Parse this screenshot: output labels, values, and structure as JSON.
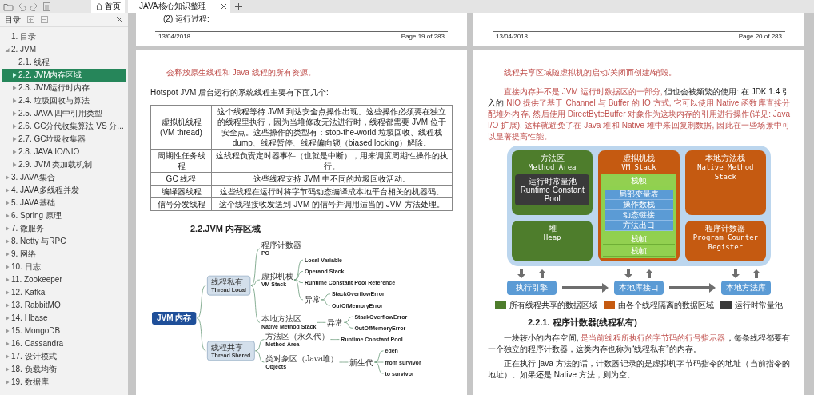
{
  "sidebar": {
    "home_label": "首页",
    "outline": {
      "title": "目录",
      "items": [
        {
          "label": "1. 目录",
          "selected": false
        },
        {
          "label": "2. JVM",
          "selected": false,
          "expanded": true,
          "children": [
            {
              "label": "2.1. 线程",
              "selected": false
            },
            {
              "label": "2.2. JVM内存区域",
              "selected": true,
              "expanded": false
            },
            {
              "label": "2.3. JVM运行时内存",
              "selected": false,
              "expanded": false
            },
            {
              "label": "2.4. 垃圾回收与算法",
              "selected": false,
              "expanded": false
            },
            {
              "label": "2.5. JAVA 四中引用类型",
              "selected": false,
              "expanded": false
            },
            {
              "label": "2.6. GC分代收集算法  VS 分...",
              "selected": false,
              "expanded": false
            },
            {
              "label": "2.7. GC垃圾收集器",
              "selected": false,
              "expanded": false
            },
            {
              "label": "2.8.  JAVA IO/NIO",
              "selected": false,
              "expanded": false
            },
            {
              "label": "2.9. JVM 类加载机制",
              "selected": false,
              "expanded": false
            }
          ]
        },
        {
          "label": "3. JAVA集合",
          "selected": false,
          "expanded": false
        },
        {
          "label": "4. JAVA多线程并发",
          "selected": false,
          "expanded": false
        },
        {
          "label": "5. JAVA基础",
          "selected": false,
          "expanded": false
        },
        {
          "label": "6. Spring 原理",
          "selected": false,
          "expanded": false
        },
        {
          "label": "7.  微服务",
          "selected": false,
          "expanded": false
        },
        {
          "label": "8. Netty 与RPC",
          "selected": false,
          "expanded": false
        },
        {
          "label": "9. 网络",
          "selected": false,
          "expanded": false
        },
        {
          "label": "10. 日志",
          "selected": false,
          "expanded": false
        },
        {
          "label": "11. Zookeeper",
          "selected": false,
          "expanded": false
        },
        {
          "label": "12. Kafka",
          "selected": false,
          "expanded": false
        },
        {
          "label": "13. RabbitMQ",
          "selected": false,
          "expanded": false
        },
        {
          "label": "14. Hbase",
          "selected": false,
          "expanded": false
        },
        {
          "label": "15. MongoDB",
          "selected": false,
          "expanded": false
        },
        {
          "label": "16. Cassandra",
          "selected": false,
          "expanded": false
        },
        {
          "label": "17. 设计模式",
          "selected": false,
          "expanded": false
        },
        {
          "label": "18. 负载均衡",
          "selected": false,
          "expanded": false
        },
        {
          "label": "19. 数据库",
          "selected": false,
          "expanded": false
        }
      ]
    }
  },
  "tabs": [
    {
      "label": "JAVA核心知识整理",
      "selected": true
    }
  ],
  "pages": [
    {
      "tail": {
        "text": "(2) 运行过程:",
        "date": "13/04/2018",
        "page": "Page 19 of 283"
      },
      "blocks": [
        {
          "kind": "note",
          "text": "会释放原生线程和 Java 线程的所有资源。"
        },
        {
          "kind": "text",
          "segments": [
            {
              "text": "Hotspot JVM 后台运行的系统线程主要有下面几个:",
              "highlight": false
            }
          ]
        },
        {
          "kind": "table",
          "rows": [
            [
              "虚拟机线程\n(VM thread)",
              "这个线程等待 JVM 到达安全点操作出现。这些操作必须要在独立的线程里执行，因为当堆修改无法进行时，线程都需要 JVM 位于安全点。这些操作的类型有：stop-the-world 垃圾回收、线程栈 dump、线程暂停、线程偏向锁（biased locking）解除。"
            ],
            [
              "周期性任务线程",
              "这线程负责定时器事件（也就是中断），用来调度周期性操作的执行。"
            ],
            [
              "GC 线程",
              "这些线程支持 JVM 中不同的垃圾回收活动。"
            ],
            [
              "编译器线程",
              "这些线程在运行时将字节码动态编译成本地平台相关的机器码。"
            ],
            [
              "信号分发线程",
              "这个线程接收发送到 JVM 的信号并调用适当的 JVM 方法处理。"
            ]
          ]
        },
        {
          "kind": "heading",
          "text": "2.2.JVM 内存区域"
        },
        {
          "kind": "mindmap",
          "tree": {
            "title": "JVM 内存",
            "children": [
              {
                "title": "线程私有",
                "subtitle": "Thread Local",
                "children": [
                  {
                    "title": "程序计数器",
                    "subtitle": "PC"
                  },
                  {
                    "title": "虚拟机栈",
                    "subtitle": "VM Stack",
                    "children": [
                      {
                        "title": "Local Variable",
                        "kind": "term"
                      },
                      {
                        "title": "Operand Stack",
                        "kind": "term"
                      },
                      {
                        "title": "Runtime Constant Pool Reference",
                        "kind": "term"
                      },
                      {
                        "title": "异常",
                        "children": [
                          {
                            "title": "StackOverflowError",
                            "kind": "term"
                          },
                          {
                            "title": "OutOfMemoryError",
                            "kind": "term"
                          }
                        ]
                      }
                    ]
                  },
                  {
                    "title": "本地方法区",
                    "subtitle": "Native Method Stack",
                    "children": [
                      {
                        "title": "异常",
                        "children": [
                          {
                            "title": "StackOverflowError",
                            "kind": "term"
                          },
                          {
                            "title": "OutOfMemoryError",
                            "kind": "term"
                          }
                        ]
                      }
                    ]
                  }
                ]
              },
              {
                "title": "线程共享",
                "subtitle": "Thread Shared",
                "children": [
                  {
                    "title": "方法区（永久代）",
                    "subtitle": "Method Area",
                    "children": [
                      {
                        "title": "Runtime Constant Pool",
                        "kind": "term"
                      }
                    ]
                  },
                  {
                    "title": "类对象区（Java堆）",
                    "subtitle": "Objects",
                    "children": [
                      {
                        "title": "新生代",
                        "children": [
                          {
                            "title": "eden",
                            "kind": "term"
                          },
                          {
                            "title": "from survivor",
                            "kind": "term"
                          },
                          {
                            "title": "to survivor",
                            "kind": "term"
                          }
                        ]
                      }
                    ]
                  }
                ]
              }
            ]
          }
        }
      ]
    },
    {
      "tail": {
        "date": "13/04/2018",
        "page": "Page 20 of 283"
      },
      "blocks": [
        {
          "kind": "note",
          "text": "线程共享区域随虚拟机的启动/关闭而创建/销毁。"
        },
        {
          "kind": "paragraph",
          "segments": [
            {
              "text": "直接内存并不是 JVM 运行时数据区的一部分, ",
              "highlight": true
            },
            {
              "text": "但也会被频繁的使用: 在 JDK 1.4 引入的 ",
              "highlight": false
            },
            {
              "text": "NIO 提供了基于 Channel 与 Buffer 的 IO 方式, 它可以使用 Native 函数库直接分配堆外内存, 然后使用 DirectByteBuffer 对象作为这块内存的引用进行操作(详见: Java I/O 扩展), 这样就避免了在 Java 堆和 Native 堆中来回复制数据, 因此在一些场景中可以显著提高性能。",
              "highlight": true
            }
          ]
        },
        {
          "kind": "diagram",
          "areas": [
            {
              "kind": "shared",
              "title": "方法区",
              "subtitle": "Method Area",
              "inner": {
                "kind": "pool",
                "title": "运行时常量池",
                "subtitle": "Runtime Constant Pool"
              }
            },
            {
              "kind": "private",
              "title": "虚拟机栈",
              "subtitle": "VM Stack",
              "frames": [
                {
                  "label": "栈帧",
                  "entries": [
                    "局部变量表",
                    "操作数栈",
                    "动态链接",
                    "方法出口"
                  ]
                },
                {
                  "label": "栈帧"
                },
                {
                  "label": "栈帧"
                }
              ]
            },
            {
              "kind": "private",
              "title": "本地方法栈",
              "subtitle": "Native Method Stack"
            },
            {
              "kind": "shared",
              "title": "堆",
              "subtitle": "Heap"
            },
            {
              "kind": "private",
              "title": "程序计数器",
              "subtitle": "Program Counter Register"
            }
          ],
          "interfaces": [
            "执行引擎",
            "本地库接口",
            "本地方法库"
          ],
          "legend": [
            {
              "kind": "shared",
              "label": "所有线程共享的数据区域"
            },
            {
              "kind": "private",
              "label": "由各个线程隔离的数据区域"
            },
            {
              "kind": "pool",
              "label": "运行时常量池"
            }
          ]
        },
        {
          "kind": "heading",
          "text": "2.2.1. 程序计数器(线程私有)"
        },
        {
          "kind": "paragraph",
          "segments": [
            {
              "text": "一块较小的内存空间, ",
              "highlight": false
            },
            {
              "text": "是当前线程所执行的字节码的行号指示器",
              "highlight": true
            },
            {
              "text": "，每条线程都要有一个独立的程序计数器，这类内存也称为“线程私有”的内存。",
              "highlight": false
            }
          ]
        },
        {
          "kind": "paragraph",
          "segments": [
            {
              "text": "正在执行 java 方法的话，计数器记录的是虚拟机字节码指令的地址（当前指令的地址）。如果还是 Native 方法，则为空。",
              "highlight": false
            }
          ]
        }
      ]
    }
  ]
}
